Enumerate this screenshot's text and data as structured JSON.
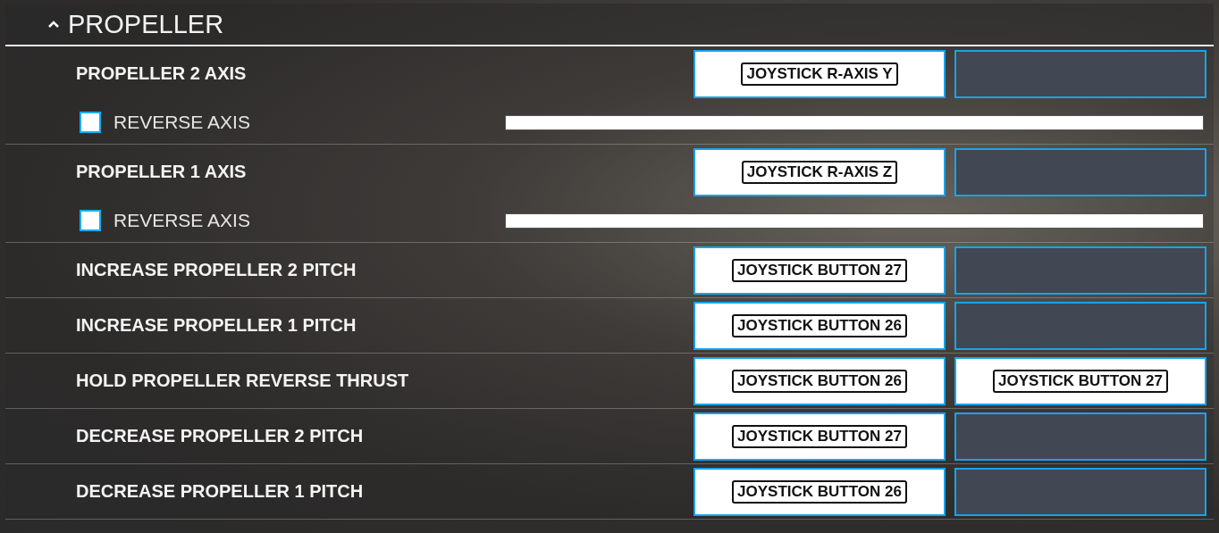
{
  "section": {
    "title": "PROPELLER",
    "expanded": true
  },
  "rows": [
    {
      "kind": "axis",
      "label": "PROPELLER 2 AXIS",
      "slots": [
        {
          "assigned": true,
          "binding": "JOYSTICK R-AXIS Y"
        },
        {
          "assigned": false
        }
      ],
      "reverse": {
        "label": "REVERSE AXIS",
        "checked": false
      }
    },
    {
      "kind": "axis",
      "label": "PROPELLER 1 AXIS",
      "slots": [
        {
          "assigned": true,
          "binding": "JOYSTICK R-AXIS Z"
        },
        {
          "assigned": false
        }
      ],
      "reverse": {
        "label": "REVERSE AXIS",
        "checked": false
      }
    },
    {
      "kind": "button",
      "label": "INCREASE PROPELLER 2 PITCH",
      "slots": [
        {
          "assigned": true,
          "binding": "JOYSTICK BUTTON 27"
        },
        {
          "assigned": false
        }
      ]
    },
    {
      "kind": "button",
      "label": "INCREASE PROPELLER 1 PITCH",
      "slots": [
        {
          "assigned": true,
          "binding": "JOYSTICK BUTTON 26"
        },
        {
          "assigned": false
        }
      ]
    },
    {
      "kind": "button",
      "label": "HOLD PROPELLER REVERSE THRUST",
      "slots": [
        {
          "assigned": true,
          "binding": "JOYSTICK BUTTON 26"
        },
        {
          "assigned": true,
          "binding": "JOYSTICK BUTTON 27"
        }
      ]
    },
    {
      "kind": "button",
      "label": "DECREASE PROPELLER 2 PITCH",
      "slots": [
        {
          "assigned": true,
          "binding": "JOYSTICK BUTTON 27"
        },
        {
          "assigned": false
        }
      ]
    },
    {
      "kind": "button",
      "label": "DECREASE PROPELLER 1 PITCH",
      "slots": [
        {
          "assigned": true,
          "binding": "JOYSTICK BUTTON 26"
        },
        {
          "assigned": false
        }
      ]
    }
  ]
}
